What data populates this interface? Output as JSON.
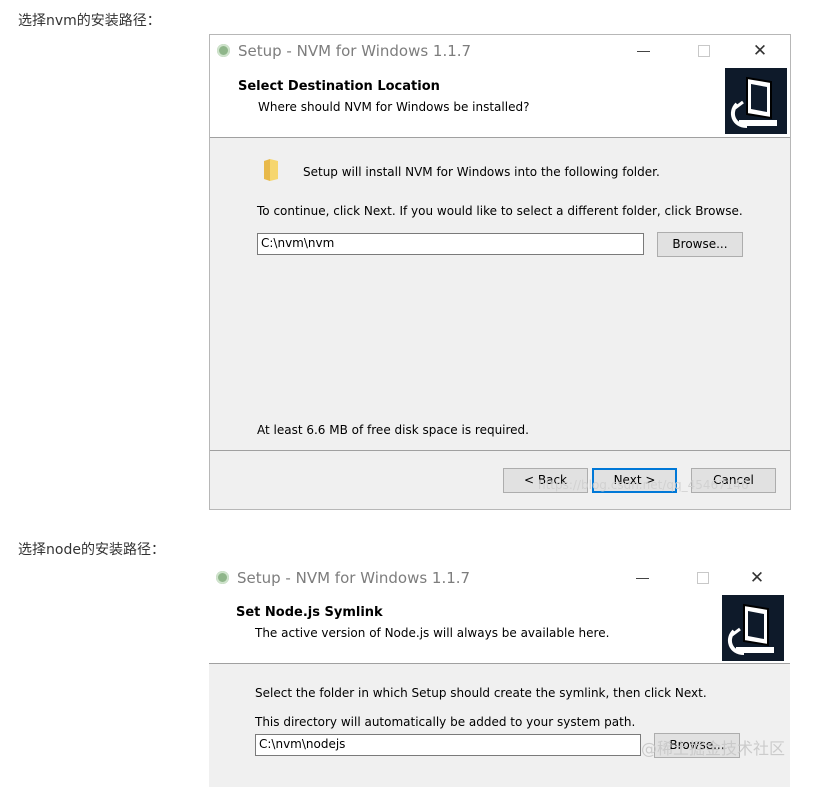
{
  "captions": {
    "first": "选择nvm的安装路径：",
    "second": "选择node的安装路径："
  },
  "dialog1": {
    "title": "Setup - NVM for Windows 1.1.7",
    "header_title": "Select Destination Location",
    "header_subtitle": "Where should NVM for Windows be installed?",
    "info": "Setup will install NVM for Windows into the following folder.",
    "instruction": "To continue, click Next. If you would like to select a different folder, click Browse.",
    "path_value": "C:\\nvm\\nvm",
    "browse_label": "Browse...",
    "disk_space": "At least 6.6 MB of free disk space is required.",
    "back_label": "< Back",
    "next_label": "Next >",
    "cancel_label": "Cancel",
    "watermark": "https://blog.csdn.net/qq_45467146"
  },
  "dialog2": {
    "title": "Setup - NVM for Windows 1.1.7",
    "header_title": "Set Node.js Symlink",
    "header_subtitle": "The active version of Node.js will always be available here.",
    "instruction": "Select the folder in which Setup should create the symlink, then click Next.",
    "note": "This directory will automatically be added to your system path.",
    "path_value": "C:\\nvm\\nodejs",
    "browse_label": "Browse...",
    "watermark": "@稀土掘金技术社区"
  },
  "colors": {
    "accent": "#0078d7",
    "body_bg": "#f0f0f0",
    "logo_bg": "#0e1a2a"
  },
  "icons": [
    "app-icon",
    "minimize-icon",
    "maximize-icon",
    "close-icon",
    "folder-icon",
    "installer-logo-icon"
  ]
}
